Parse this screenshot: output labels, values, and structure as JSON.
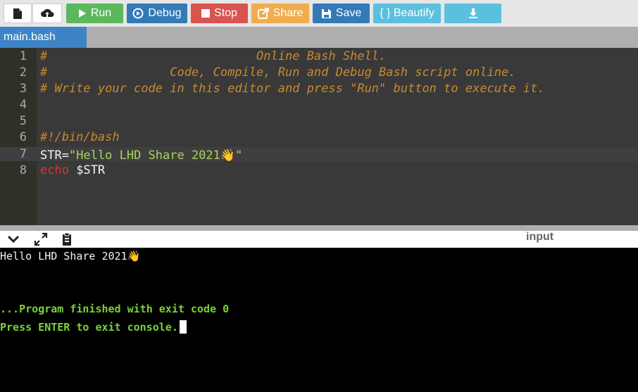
{
  "toolbar": {
    "buttons": [
      {
        "label": "",
        "icon": "new-file-icon"
      },
      {
        "label": "",
        "icon": "upload-icon"
      },
      {
        "label": "Run",
        "icon": "play-icon",
        "color": "#5cb85c"
      },
      {
        "label": "Debug",
        "icon": "debug-icon",
        "color": "#337ab7"
      },
      {
        "label": "Stop",
        "icon": "stop-icon",
        "color": "#d9534f"
      },
      {
        "label": "Share",
        "icon": "share-icon",
        "color": "#f0ad4e"
      },
      {
        "label": "Save",
        "icon": "save-icon",
        "color": "#337ab7"
      },
      {
        "label": "{ } Beautify",
        "icon": "",
        "color": "#5bc0de"
      },
      {
        "label": "",
        "icon": "download-icon",
        "color": "#5bc0de"
      }
    ]
  },
  "tabs": [
    {
      "label": "main.bash"
    }
  ],
  "editor": {
    "lines": [
      {
        "number": "1",
        "text": "#                             Online Bash Shell."
      },
      {
        "number": "2",
        "text": "#                 Code, Compile, Run and Debug Bash script online."
      },
      {
        "number": "3",
        "text": "# Write your code in this editor and press \"Run\" button to execute it."
      },
      {
        "number": "4",
        "text": ""
      },
      {
        "number": "5",
        "text": ""
      },
      {
        "number": "6",
        "text": "#!/bin/bash"
      },
      {
        "number": "7",
        "var": "STR=",
        "string": "\"Hello LHD Share 2021👋\""
      },
      {
        "number": "8",
        "keyword": "echo",
        "rest": " $STR"
      }
    ]
  },
  "console": {
    "header": {
      "input_label": "input",
      "icons": [
        "chevron-down-icon",
        "expand-icon",
        "clipboard-icon"
      ]
    },
    "lines": [
      "Hello LHD Share 2021👋",
      "...Program finished with exit code 0",
      "Press ENTER to exit console."
    ]
  },
  "colors": {
    "editor_bg": "#393939",
    "comment": "#c98a2e",
    "string": "#a9d25c",
    "keyword": "#d7392f",
    "console_green": "#78d13a",
    "tab_active": "#3d84c6"
  }
}
